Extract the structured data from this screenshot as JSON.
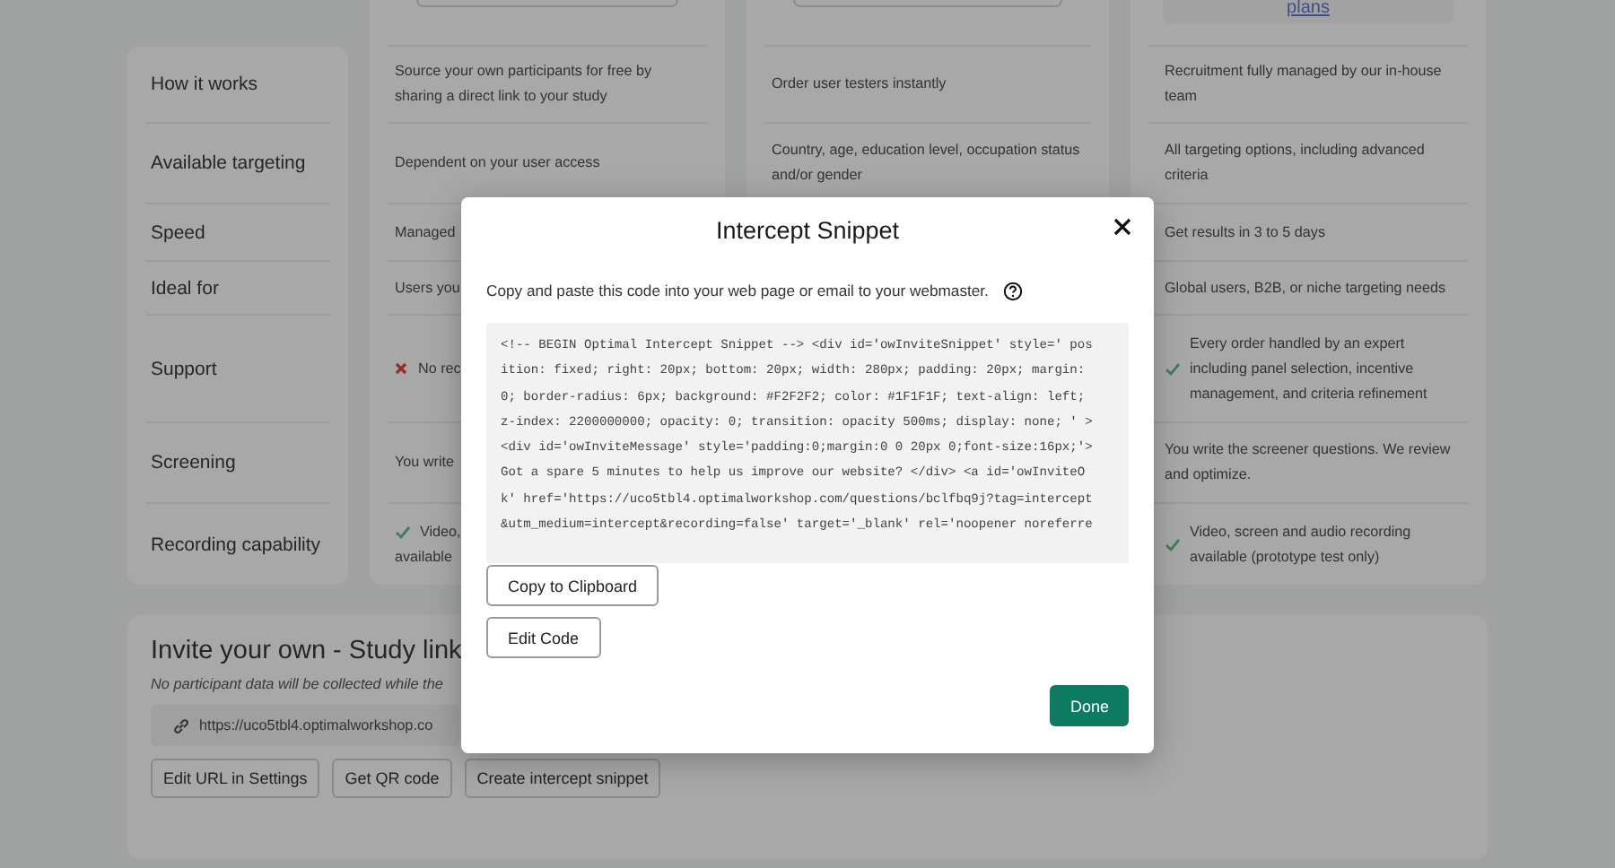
{
  "plan_columns": [
    {
      "top": {
        "kind": "button"
      }
    },
    {
      "top": {
        "kind": "button"
      }
    },
    {
      "top": {
        "kind": "link-box",
        "link": "plans"
      }
    }
  ],
  "rows": [
    {
      "label": "How it works",
      "column_1": {
        "kind": "plain",
        "text": "Source your own participants for free by sharing a direct link to your study"
      },
      "column_2": {
        "kind": "plain",
        "text": "Order user testers instantly"
      },
      "column_3": {
        "kind": "plain",
        "text": "Recruitment fully managed by our in-house team"
      }
    },
    {
      "label": "Available targeting",
      "column_1": {
        "kind": "plain",
        "text": "Dependent on your user access"
      },
      "column_2": {
        "kind": "plain",
        "text": "Country, age, education level, occupation status and/or gender"
      },
      "column_3": {
        "kind": "plain",
        "text": "All targeting options, including advanced criteria"
      }
    },
    {
      "label": "Speed",
      "column_1": {
        "kind": "plain",
        "text": "Managed"
      },
      "column_3": {
        "kind": "plain",
        "text": "Get results in 3 to 5 days"
      }
    },
    {
      "label": "Ideal for",
      "column_1": {
        "kind": "plain",
        "text": "Users you"
      },
      "column_3": {
        "kind": "plain",
        "text": "Global users, B2B, or niche targeting needs"
      }
    },
    {
      "label": "Support",
      "column_1": {
        "kind": "cross",
        "text": "No rec"
      },
      "column_3": {
        "kind": "check",
        "text": "Every order handled by an expert including panel selection, incentive management, and criteria refinement"
      }
    },
    {
      "label": "Screening",
      "column_1": {
        "kind": "plain",
        "text": "You write"
      },
      "column_3": {
        "kind": "plain",
        "text": "You write the screener questions. We review and optimize."
      }
    },
    {
      "label": "Recording capability",
      "column_1": {
        "kind": "check",
        "text": "Video,",
        "text_2": "available"
      },
      "column_3": {
        "kind": "check",
        "text": "Video, screen and audio recording available (prototype test only)"
      }
    }
  ],
  "invite": {
    "title": "Invite your own - Study link",
    "note": "No participant data will be collected while the",
    "link": "https://uco5tbl4.optimalworkshop.co",
    "buttons": [
      "Edit URL in Settings",
      "Get QR code",
      "Create intercept snippet"
    ]
  },
  "modal": {
    "title": "Intercept Snippet",
    "description": "Copy and paste this code into your web page or email to your webmaster.",
    "code_lines": [
      "<!-- BEGIN Optimal Intercept Snippet --> <div id='owInviteSnippet' style=' pos",
      "ition: fixed; right: 20px; bottom: 20px; width: 280px; padding: 20px; margin:",
      "0; border-radius: 6px; background: #F2F2F2; color: #1F1F1F; text-align: left;",
      "z-index: 2200000000; opacity: 0; transition: opacity 500ms; display: none; ' >",
      "<div id='owInviteMessage' style='padding:0;margin:0 0 20px 0;font-size:16px;'>",
      "Got a spare 5 minutes to help us improve our website? </div> <a id='owInviteO",
      "k' href='https://uco5tbl4.optimalworkshop.com/questions/bclfbq9j?tag=intercept",
      "&utm_medium=intercept&recording=false' target='_blank' rel='noopener noreferre"
    ],
    "buttons": [
      "Copy to Clipboard",
      "Edit Code"
    ],
    "primary_button": "Done"
  }
}
